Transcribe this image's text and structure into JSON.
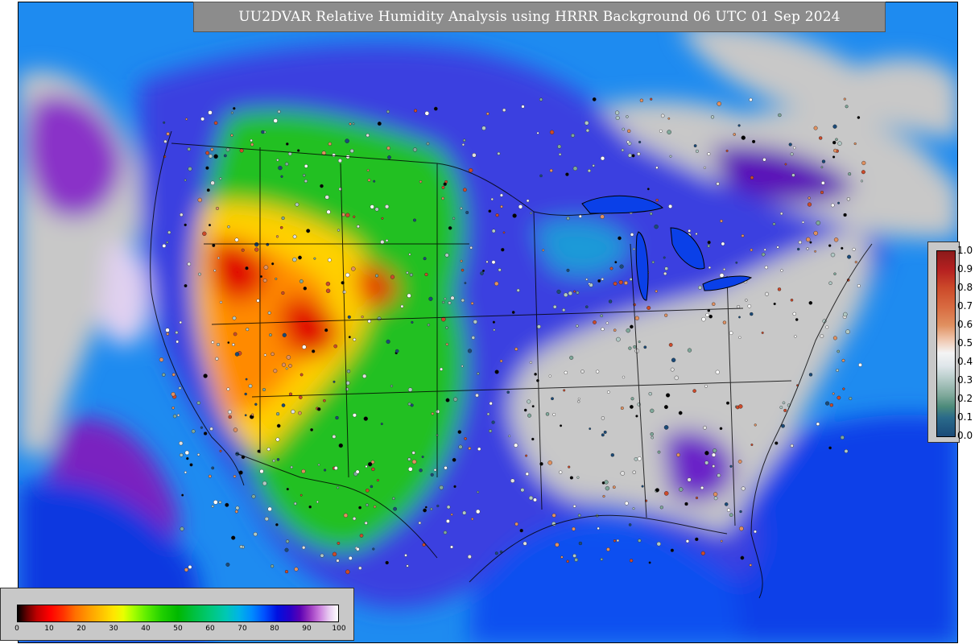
{
  "title": "UU2DVAR Relative Humidity Analysis using HRRR Background 06 UTC 01 Sep 2024",
  "colors": {
    "ocean": "#1e8bf0",
    "deep_ocean": "#0a30e0",
    "dry_gray": "#c8c8c8",
    "green": "#20c020",
    "yellow": "#ffd000",
    "orange": "#ff8a00",
    "red": "#e00000",
    "purple": "#7a00c8"
  },
  "rh_colorbar": {
    "ticks": [
      "0",
      "10",
      "20",
      "30",
      "40",
      "50",
      "60",
      "70",
      "80",
      "90",
      "100"
    ]
  },
  "obs_colorbar": {
    "ticks": [
      "1.0",
      "0.9",
      "0.8",
      "0.7",
      "0.6",
      "0.5",
      "0.4",
      "0.3",
      "0.2",
      "0.1",
      "0.0"
    ]
  }
}
